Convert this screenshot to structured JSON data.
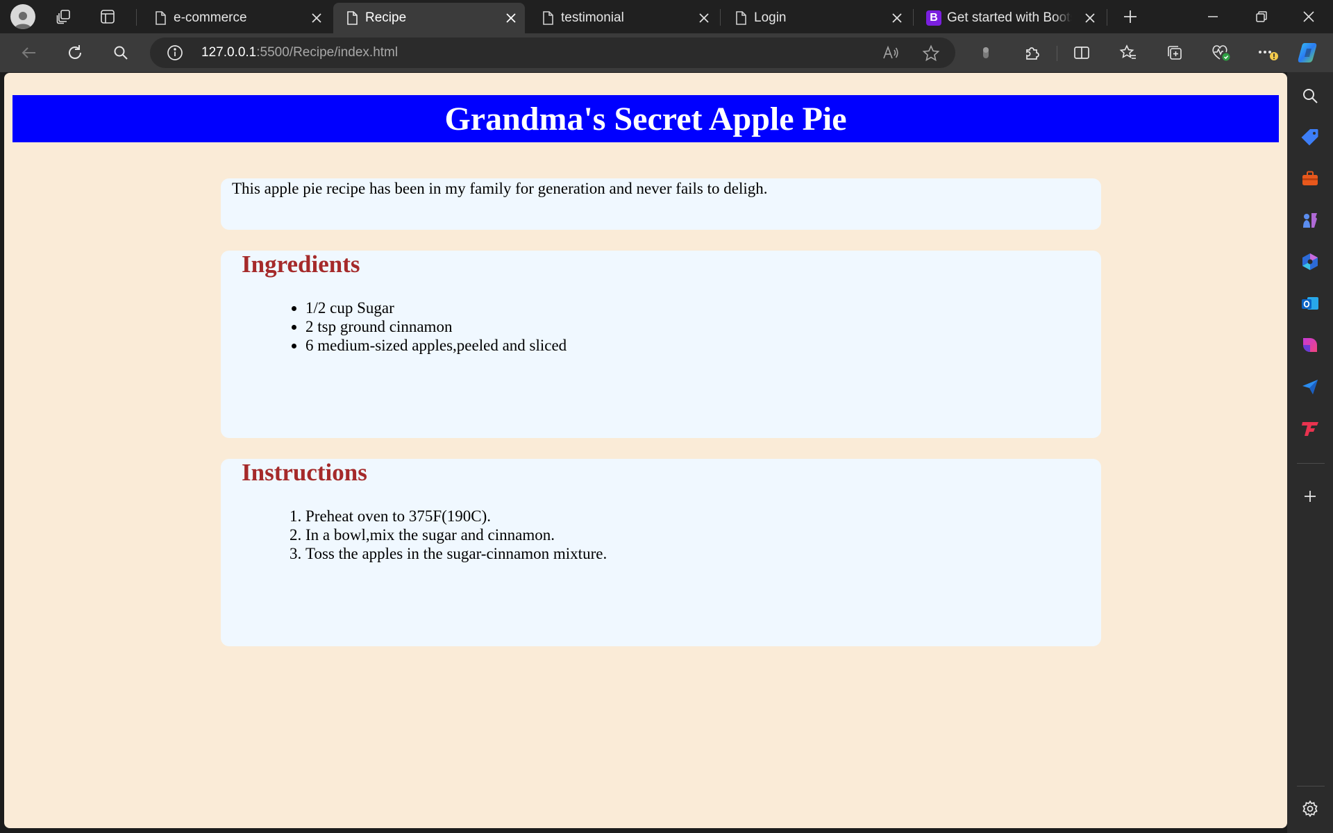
{
  "browser": {
    "tabs": [
      {
        "title": "e-commerce",
        "active": false,
        "favicon": "page-icon"
      },
      {
        "title": "Recipe",
        "active": true,
        "favicon": "page-icon"
      },
      {
        "title": "testimonial",
        "active": false,
        "favicon": "page-icon"
      },
      {
        "title": "Login",
        "active": false,
        "favicon": "page-icon"
      },
      {
        "title": "Get started with Bootst",
        "active": false,
        "favicon": "bootstrap-icon",
        "favicon_text": "B"
      }
    ],
    "address": {
      "host": "127.0.0.1",
      "rest": ":5500/Recipe/index.html"
    },
    "colors": {
      "tabstrip": "#202020",
      "toolbar": "#3b3b3b",
      "address_bar": "#2b2b2b"
    }
  },
  "page": {
    "title": "Grandma's Secret Apple Pie",
    "intro": "This apple pie recipe has been in my family for generation and never fails to deligh.",
    "ingredients": {
      "heading": "Ingredients",
      "items": [
        "1/2 cup Sugar",
        "2 tsp ground cinnamon",
        "6 medium-sized apples,peeled and sliced"
      ]
    },
    "instructions": {
      "heading": "Instructions",
      "steps": [
        "Preheat oven to 375F(190C).",
        "In a bowl,mix the sugar and cinnamon.",
        "Toss the apples in the sugar-cinnamon mixture."
      ]
    },
    "colors": {
      "background": "#faebd7",
      "header": "#0000ff",
      "card": "#f0f8ff",
      "heading": "#a52a2a"
    }
  }
}
